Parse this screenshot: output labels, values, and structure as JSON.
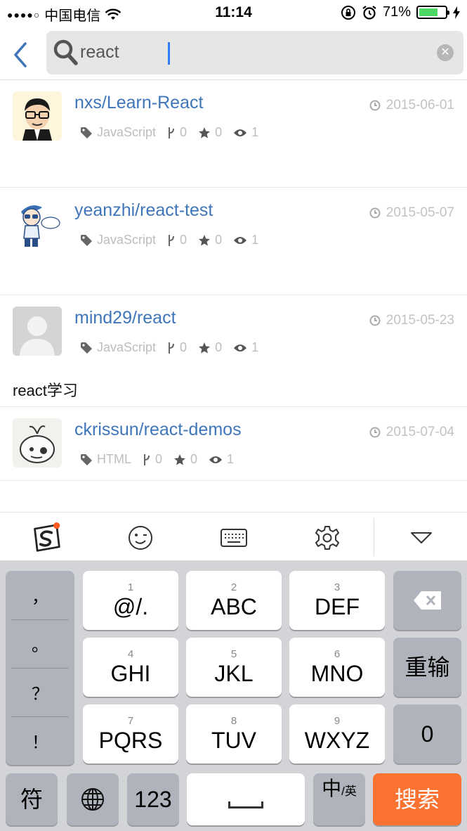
{
  "status_bar": {
    "carrier": "中国电信",
    "time": "11:14",
    "battery": "71%",
    "battery_level": 0.71
  },
  "search": {
    "query": "react",
    "clear_label": "✕"
  },
  "repos": [
    {
      "name": "nxs/Learn-React",
      "date": "2015-06-01",
      "language": "JavaScript",
      "forks": "0",
      "stars": "0",
      "watchers": "1",
      "description": ""
    },
    {
      "name": "yeanzhi/react-test",
      "date": "2015-05-07",
      "language": "JavaScript",
      "forks": "0",
      "stars": "0",
      "watchers": "1",
      "description": ""
    },
    {
      "name": "mind29/react",
      "date": "2015-05-23",
      "language": "JavaScript",
      "forks": "0",
      "stars": "0",
      "watchers": "1",
      "description": "react学习"
    },
    {
      "name": "ckrissun/react-demos",
      "date": "2015-07-04",
      "language": "HTML",
      "forks": "0",
      "stars": "0",
      "watchers": "1",
      "description": ""
    }
  ],
  "keyboard": {
    "punctuation": [
      "，",
      "。",
      "？",
      "！"
    ],
    "keys": [
      {
        "num": "1",
        "label": "@/."
      },
      {
        "num": "2",
        "label": "ABC"
      },
      {
        "num": "3",
        "label": "DEF"
      },
      {
        "num": "4",
        "label": "GHI"
      },
      {
        "num": "5",
        "label": "JKL"
      },
      {
        "num": "6",
        "label": "MNO"
      },
      {
        "num": "7",
        "label": "PQRS"
      },
      {
        "num": "8",
        "label": "TUV"
      },
      {
        "num": "9",
        "label": "WXYZ"
      }
    ],
    "reenter": "重输",
    "zero": "0",
    "symbols": "符",
    "num123": "123",
    "lang_main": "中",
    "lang_sub": "/英",
    "search": "搜索"
  },
  "colors": {
    "link": "#3f76b9",
    "search_key": "#fc7230",
    "caret": "#2f7cf6"
  }
}
